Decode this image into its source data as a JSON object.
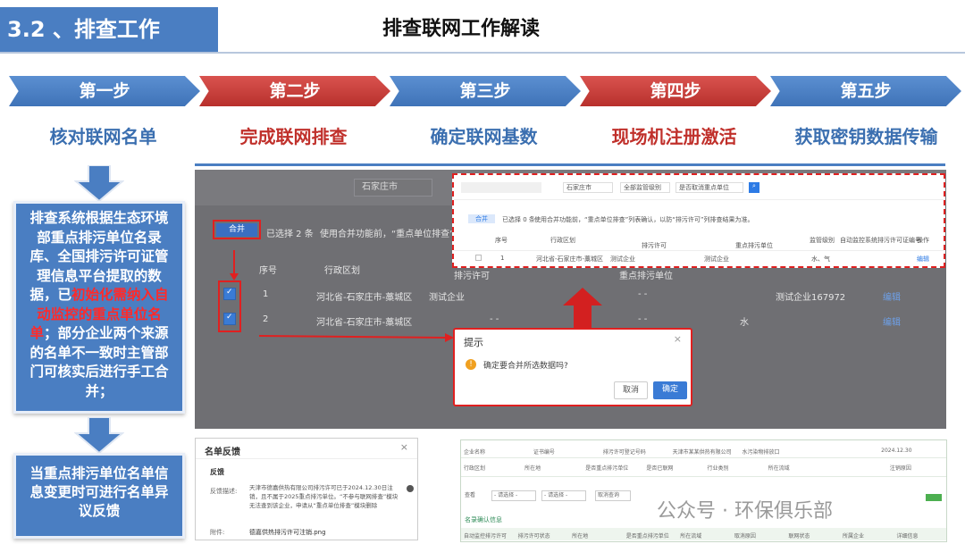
{
  "header": {
    "section_tag": "3.2 、排查工作",
    "title": "排查联网工作解读"
  },
  "steps": [
    {
      "label": "第一步",
      "name": "核对联网名单",
      "color": "blue"
    },
    {
      "label": "第二步",
      "name": "完成联网排查",
      "color": "red"
    },
    {
      "label": "第三步",
      "name": "确定联网基数",
      "color": "blue"
    },
    {
      "label": "第四步",
      "name": "现场机注册激活",
      "color": "red"
    },
    {
      "label": "第五步",
      "name": "获取密钥数据传输",
      "color": "blue"
    }
  ],
  "left_panel": {
    "box1_text_a": "排查系统根据生态环境部重点排污单位名录库、全国排污许可证管理信息平台提取的数据，已",
    "box1_text_red": "初始化需纳入自动监控的重点单位名单",
    "box1_text_b": "；部分企业两个来源的名单不一致时主管部门可核实后进行手工合并；",
    "box2_text": "当重点排污单位名单信息变更时可进行名单异议反馈"
  },
  "screenshot": {
    "search_placeholder": "石家庄市",
    "merge_button": "合并",
    "selected_text": "已选择 2 条",
    "hint_text": "使用合并功能前，“重点单位排查”列表确认",
    "col_seq": "序号",
    "col_region": "行政区划",
    "col_permit": "排污许可",
    "col_key_unit": "重点排污单位",
    "rows": [
      {
        "seq": "1",
        "region": "河北省-石家庄市-藁城区",
        "company": "测试企业",
        "permit": "- -",
        "right": "测试企业167972",
        "action": "编辑"
      },
      {
        "seq": "2",
        "region": "河北省-石家庄市-藁城区",
        "company": "- -",
        "permit": "- -",
        "right": "水",
        "action": "编辑"
      }
    ]
  },
  "inset": {
    "city": "石家庄市",
    "filter1": "全部监管级别",
    "filter2": "是否取消重点单位",
    "merge_button": "合并",
    "selected_text": "已选择 0 条",
    "hint": "使用合并功能前，“重点单位排查”列表确认，以防“排污许可”列排查结果为准。",
    "headers": [
      "序号",
      "行政区划",
      "排污许可",
      "重点排污单位",
      "监管级别",
      "自动监控系统排污许可证编号",
      "操作"
    ],
    "row": {
      "seq": "1",
      "region": "河北省-石家庄市-藁城区",
      "permit": "测试企业",
      "key_unit": "测试企业",
      "level": "水、气",
      "action": "编辑"
    }
  },
  "dialog": {
    "title": "提示",
    "message": "确定要合并所选数据吗?",
    "cancel": "取消",
    "confirm": "确定"
  },
  "feedback": {
    "title": "名单反馈",
    "section": "反馈",
    "field_label": "反馈描述:",
    "field_text": "天津市德嘉供热有限公司排污许可已于2024.12.30日注销，且不属于2025重点排污单位。“不参与联网排查”模块无法查到该企业，申请从“重点单位排查”模块删除",
    "attach_label": "附件:",
    "attachment": "德嘉供热排污许可注销.png"
  },
  "table2": {
    "row1": [
      "企业名称",
      "证书编号",
      "排污许可登记号码",
      "天津市某某供热有限公司",
      "水污染物排放口",
      "",
      "2024.12.30"
    ],
    "row2": [
      "行政区划",
      "所在地",
      "是否重点排污单位",
      "是否已联网",
      "行业类别",
      "所在流域",
      "",
      "注销原因"
    ],
    "row3": [
      "查看",
      "- 请选择 -",
      "- 请选择 -",
      "取消查询",
      "",
      "",
      ""
    ],
    "tab": "名录确认信息",
    "row4": [
      "自动监控排污许可",
      "排污许可状态",
      "所在地",
      "是否重点排污单位",
      "所在流域",
      "取消原因",
      "联网状态",
      "所属企业",
      "详细信息"
    ]
  },
  "watermark": "公众号 · 环保俱乐部"
}
